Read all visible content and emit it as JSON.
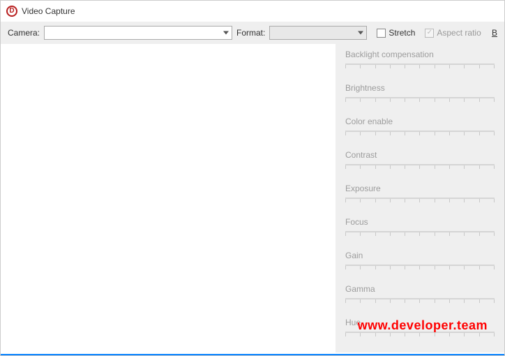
{
  "window": {
    "title": "Video Capture"
  },
  "toolbar": {
    "camera_label": "Camera:",
    "camera_value": "",
    "format_label": "Format:",
    "format_value": "",
    "stretch_label": "Stretch",
    "stretch_checked": false,
    "aspect_label": "Aspect ratio",
    "aspect_checked": true,
    "right_link": "B"
  },
  "controls": [
    {
      "label": "Backlight compensation"
    },
    {
      "label": "Brightness"
    },
    {
      "label": "Color enable"
    },
    {
      "label": "Contrast"
    },
    {
      "label": "Exposure"
    },
    {
      "label": "Focus"
    },
    {
      "label": "Gain"
    },
    {
      "label": "Gamma"
    },
    {
      "label": "Hue"
    }
  ],
  "watermark": "www.developer.team"
}
